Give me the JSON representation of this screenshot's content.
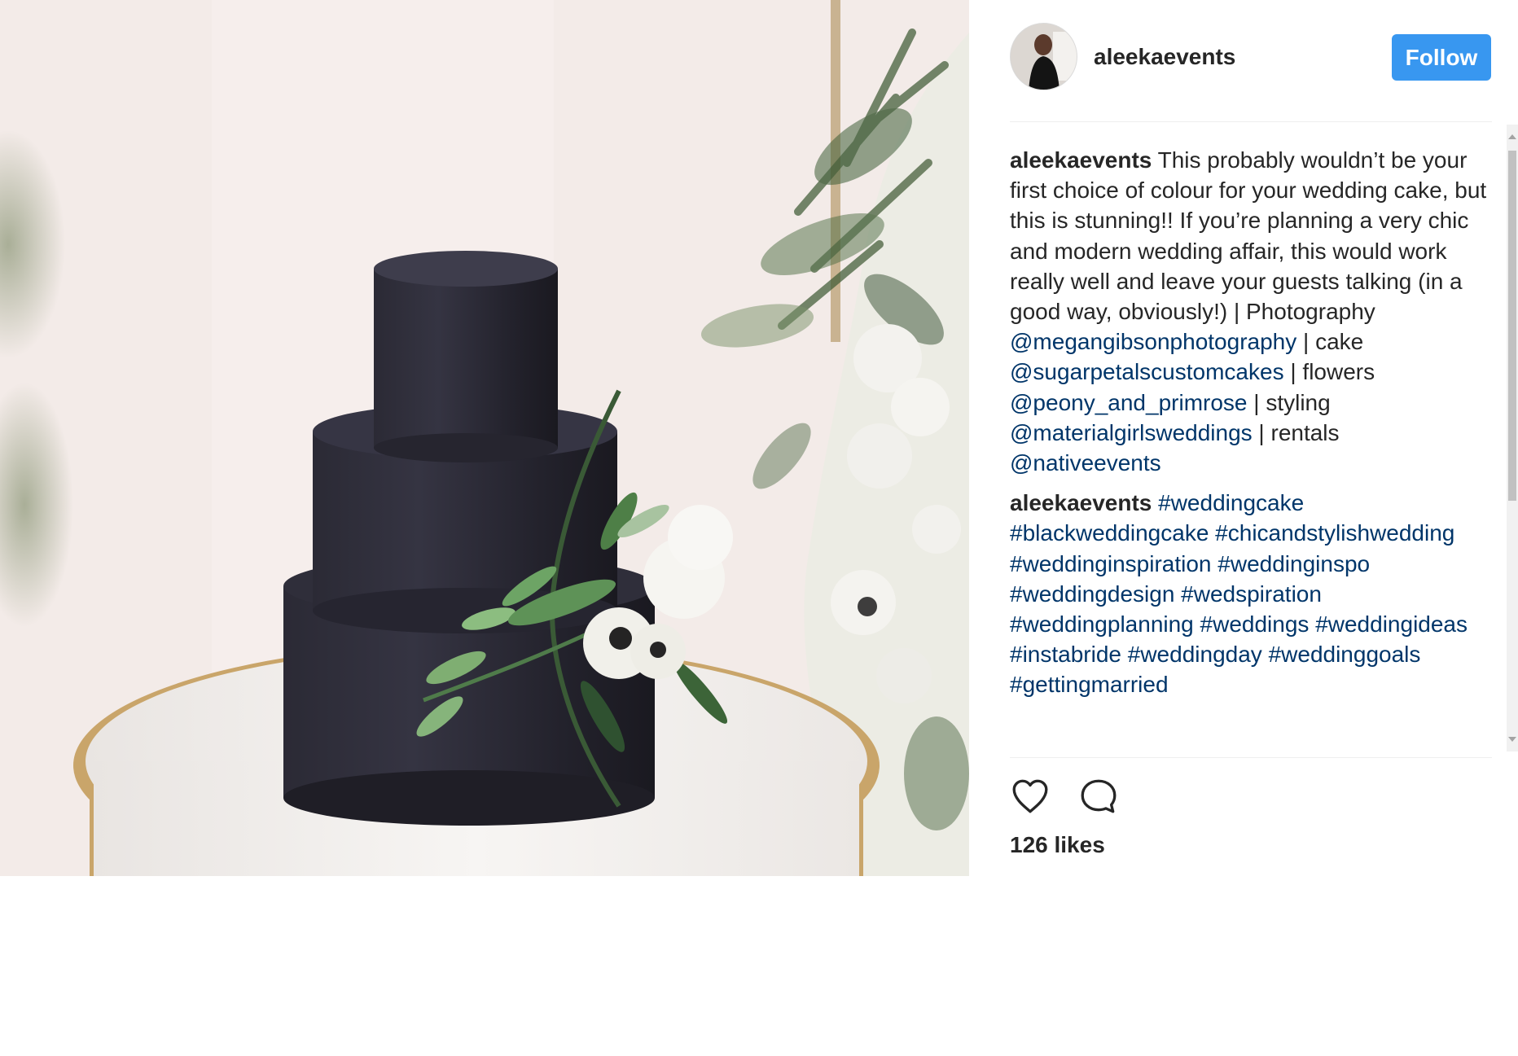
{
  "post": {
    "username": "aleekaevents",
    "follow_label": "Follow",
    "likes": "126 likes"
  },
  "comments": [
    {
      "user": "aleekaevents",
      "segments": [
        {
          "text": " This probably wouldn’t be your first choice of colour for your wedding cake, but this is stunning!! If you’re planning a very chic and modern wedding affair, this would work really well and leave your guests talking (in a good way, obviously!) | Photography ",
          "link": false
        },
        {
          "text": "@megangibsonphotography",
          "link": true
        },
        {
          "text": " | cake ",
          "link": false
        },
        {
          "text": "@sugarpetalscustomcakes",
          "link": true
        },
        {
          "text": " | flowers ",
          "link": false
        },
        {
          "text": "@peony_and_primrose",
          "link": true
        },
        {
          "text": " | styling ",
          "link": false
        },
        {
          "text": "@materialgirlsweddings",
          "link": true
        },
        {
          "text": " | rentals ",
          "link": false
        },
        {
          "text": "@nativeevents",
          "link": true
        }
      ]
    },
    {
      "user": "aleekaevents",
      "segments": [
        {
          "text": " ",
          "link": false
        },
        {
          "text": "#weddingcake",
          "link": true
        },
        {
          "text": " ",
          "link": false
        },
        {
          "text": "#blackweddingcake",
          "link": true
        },
        {
          "text": " ",
          "link": false
        },
        {
          "text": "#chicandstylishwedding",
          "link": true
        },
        {
          "text": " ",
          "link": false
        },
        {
          "text": "#weddinginspiration",
          "link": true
        },
        {
          "text": " ",
          "link": false
        },
        {
          "text": "#weddinginspo",
          "link": true
        },
        {
          "text": " ",
          "link": false
        },
        {
          "text": "#weddingdesign",
          "link": true
        },
        {
          "text": " ",
          "link": false
        },
        {
          "text": "#wedspiration",
          "link": true
        },
        {
          "text": " ",
          "link": false
        },
        {
          "text": "#weddingplanning",
          "link": true
        },
        {
          "text": " ",
          "link": false
        },
        {
          "text": "#weddings",
          "link": true
        },
        {
          "text": " ",
          "link": false
        },
        {
          "text": "#weddingideas",
          "link": true
        },
        {
          "text": " ",
          "link": false
        },
        {
          "text": "#instabride",
          "link": true
        },
        {
          "text": " ",
          "link": false
        },
        {
          "text": "#weddingday",
          "link": true
        },
        {
          "text": " ",
          "link": false
        },
        {
          "text": "#weddinggoals",
          "link": true
        },
        {
          "text": " ",
          "link": false
        },
        {
          "text": "#gettingmarried",
          "link": true
        }
      ]
    }
  ],
  "icons": {
    "like": "heart-icon",
    "comment": "comment-bubble-icon"
  },
  "colors": {
    "follow_button": "#3897f0",
    "link": "#003569",
    "text": "#262626"
  }
}
